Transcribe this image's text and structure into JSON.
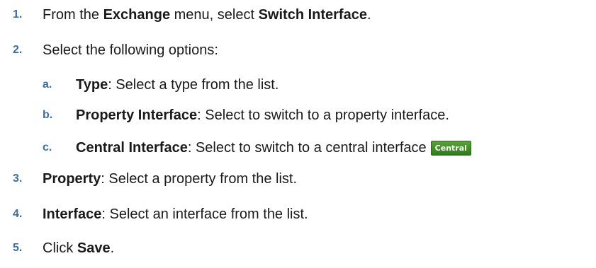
{
  "steps": [
    {
      "number": "1.",
      "parts": [
        "From the ",
        "Exchange",
        " menu, select ",
        "Switch Interface",
        "."
      ]
    },
    {
      "number": "2.",
      "text": "Select the following options:",
      "substeps": [
        {
          "letter": "a.",
          "term": "Type",
          "rest": ": Select a type from the list."
        },
        {
          "letter": "b.",
          "term": "Property Interface",
          "rest": ": Select to switch to a property interface."
        },
        {
          "letter": "c.",
          "term": "Central Interface",
          "rest": ": Select to switch to a central interface",
          "badge": "Central"
        }
      ]
    },
    {
      "number": "3.",
      "term": "Property",
      "rest": ": Select a property from the list."
    },
    {
      "number": "4.",
      "term": "Interface",
      "rest": ": Select an interface from the list."
    },
    {
      "number": "5.",
      "parts": [
        "Click ",
        "Save",
        "."
      ]
    }
  ],
  "colors": {
    "step_number": "#3a6ea5",
    "badge_green": "#3f8f28"
  }
}
